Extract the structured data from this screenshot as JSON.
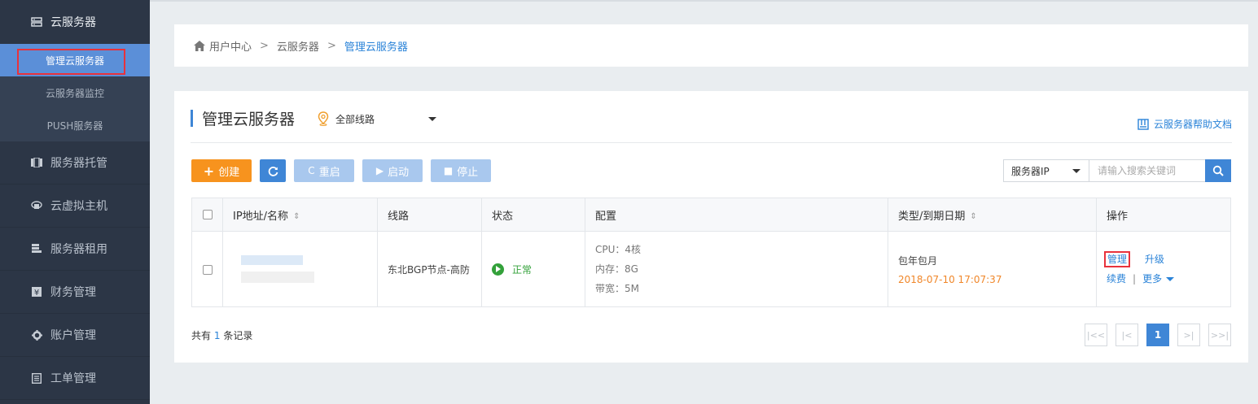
{
  "sidebar": {
    "top_label": "云服务器",
    "sub_items": [
      {
        "label": "管理云服务器",
        "active": true
      },
      {
        "label": "云服务器监控",
        "active": false
      },
      {
        "label": "PUSH服务器",
        "active": false
      }
    ],
    "items": [
      {
        "label": "服务器托管",
        "icon": "hosting-icon"
      },
      {
        "label": "云虚拟主机",
        "icon": "virtual-host-icon"
      },
      {
        "label": "服务器租用",
        "icon": "server-rent-icon"
      },
      {
        "label": "财务管理",
        "icon": "finance-icon"
      },
      {
        "label": "账户管理",
        "icon": "gear-icon"
      },
      {
        "label": "工单管理",
        "icon": "ticket-icon"
      }
    ]
  },
  "breadcrumb": {
    "items": [
      "用户中心",
      "云服务器",
      "管理云服务器"
    ],
    "separator": ">"
  },
  "panel": {
    "title": "管理云服务器",
    "route_label": "全部线路",
    "help_link": "云服务器帮助文档"
  },
  "toolbar": {
    "create": "创建",
    "restart": "重启",
    "start": "启动",
    "stop": "停止"
  },
  "search": {
    "field": "服务器IP",
    "placeholder": "请输入搜索关键词"
  },
  "table": {
    "headers": [
      "IP地址/名称",
      "线路",
      "状态",
      "配置",
      "类型/到期日期",
      "操作"
    ],
    "rows": [
      {
        "route": "东北BGP节点-高防",
        "status": "正常",
        "cpu": "CPU：4核",
        "memory": "内存：8G",
        "bandwidth": "带宽：5M",
        "type": "包年包月",
        "expire": "2018-07-10 17:07:37",
        "ops": {
          "manage": "管理",
          "upgrade": "升级",
          "renew": "续费",
          "more": "更多"
        }
      }
    ]
  },
  "footer": {
    "total_prefix": "共有",
    "total_count": "1",
    "total_suffix": "条记录",
    "current_page": "1"
  },
  "colors": {
    "sidebar_bg": "#2c3646",
    "active_blue": "#5b8fd8",
    "primary": "#3f86d6",
    "create_orange": "#f7931e",
    "status_green": "#33a13a",
    "highlight_red": "#e8323c"
  }
}
